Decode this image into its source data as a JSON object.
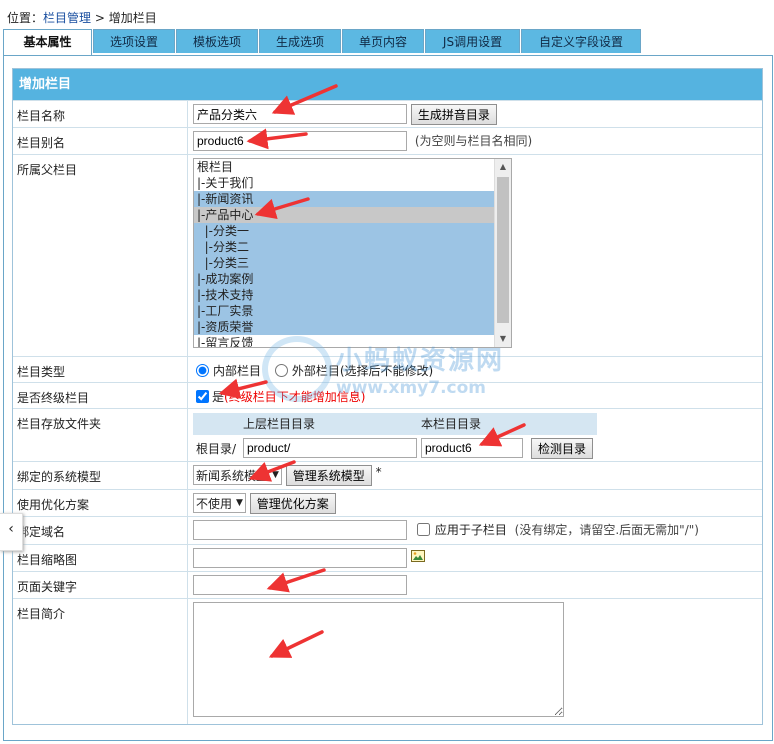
{
  "breadcrumb": {
    "prefix": "位置：",
    "link": "栏目管理",
    "sep": " > ",
    "current": "增加栏目"
  },
  "tabs": [
    "基本属性",
    "选项设置",
    "模板选项",
    "生成选项",
    "单页内容",
    "JS调用设置",
    "自定义字段设置"
  ],
  "panel_title": "增加栏目",
  "fields": {
    "name": {
      "label": "栏目名称",
      "value": "产品分类六",
      "button": "生成拼音目录"
    },
    "alias": {
      "label": "栏目别名",
      "value": "product6",
      "hint": "(为空则与栏目名相同)"
    },
    "parent": {
      "label": "所属父栏目",
      "options": [
        "根栏目",
        "|-关于我们",
        "|-新闻资讯",
        "|-产品中心",
        "  |-分类一",
        "  |-分类二",
        "  |-分类三",
        "|-成功案例",
        "|-技术支持",
        "|-工厂实景",
        "|-资质荣誉",
        "|-留言反馈"
      ]
    },
    "type": {
      "label": "栏目类型",
      "internal": "内部栏目",
      "external": "外部栏目",
      "external_hint": "(选择后不能修改)"
    },
    "final": {
      "label": "是否终级栏目",
      "checkbox_label": "是",
      "hint": "(终级栏目下才能增加信息)"
    },
    "folder": {
      "label": "栏目存放文件夹",
      "col_parent": "上层栏目目录",
      "col_self": "本栏目目录",
      "root_label": "根目录/",
      "parent_value": "product/",
      "self_value": "product6",
      "button": "检测目录"
    },
    "model": {
      "label": "绑定的系统模型",
      "selected": "新闻系统模型",
      "button": "管理系统模型",
      "required": "*"
    },
    "optimize": {
      "label": "使用优化方案",
      "selected": "不使用",
      "button": "管理优化方案"
    },
    "domain": {
      "label": "绑定域名",
      "value": "",
      "apply_label": "应用于子栏目",
      "hint": "(没有绑定，请留空.后面无需加\"/\")"
    },
    "thumb": {
      "label": "栏目缩略图",
      "value": ""
    },
    "keywords": {
      "label": "页面关键字",
      "value": ""
    },
    "intro": {
      "label": "栏目简介",
      "value": ""
    }
  },
  "watermark": {
    "big": "小蚂蚁资源网",
    "small": "www.xmy7.com"
  },
  "side_tab_glyph": "‹",
  "colors": {
    "tab": "#5cb8e2",
    "panel_title": "#55b3e0",
    "selected_option": "#9cc4e4",
    "arrow": "#ee3333"
  }
}
